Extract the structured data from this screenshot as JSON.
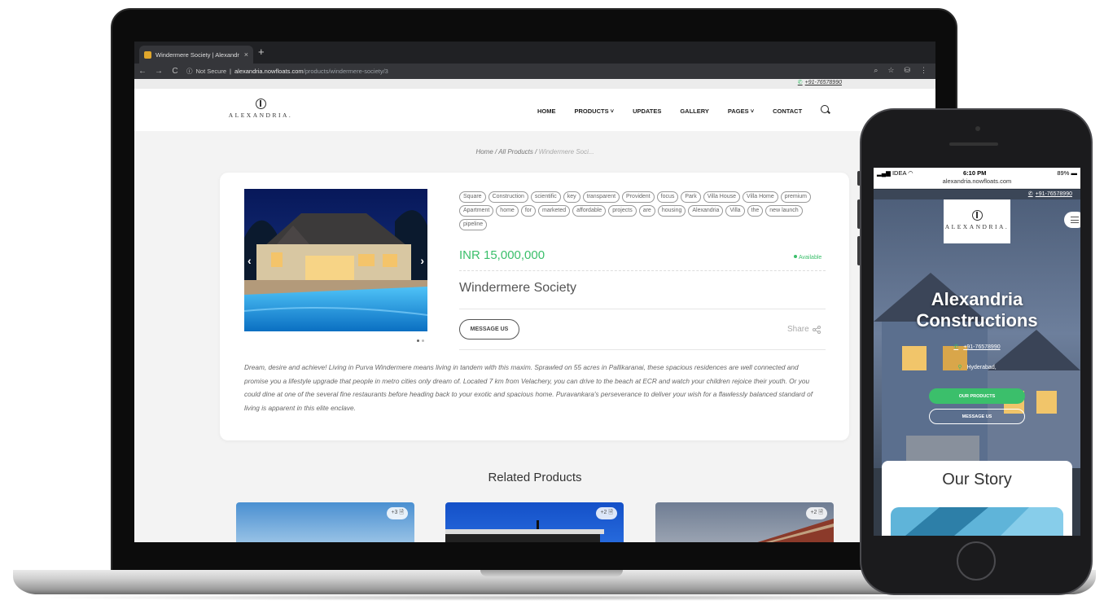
{
  "browser": {
    "tab_title": "Windermere Society | Alexandr",
    "tab_close": "×",
    "new_tab": "+",
    "security": "Not Secure",
    "url_host": "alexandria.nowfloats.com",
    "url_path": "/products/windermere-society/3",
    "nav_back": "←",
    "nav_forward": "→",
    "nav_reload": "C"
  },
  "site": {
    "phone": "+91-76578990",
    "logo_text": "ALEXANDRIA.",
    "menu": [
      "HOME",
      "PRODUCTS ˅",
      "UPDATES",
      "GALLERY",
      "PAGES ˅",
      "CONTACT"
    ],
    "breadcrumb": {
      "home": "Home",
      "sep1": "/",
      "all": "All Products",
      "sep2": "/",
      "current": "Windermere Soci..."
    }
  },
  "product": {
    "tags": [
      "Square",
      "Construction",
      "scientific",
      "key",
      "transparent",
      "Provident",
      "focus",
      "Park",
      "Villa House",
      "Villa Home",
      "premium",
      "Apartment",
      "home",
      "for",
      "marketed",
      "affordable",
      "projects",
      "are",
      "housing",
      "Alexandria",
      "Villa",
      "the",
      "new launch",
      "pipeline"
    ],
    "price": "INR 15,000,000",
    "availability": "Available",
    "name": "Windermere Society",
    "message_button": "MESSAGE US",
    "share_label": "Share",
    "description": "Dream, desire and achieve! Living in Purva Windermere means living in tandem with this maxim. Sprawled on 55 acres in Pallikaranai, these spacious residences are well connected and promise you a lifestyle upgrade that people in metro cities only dream of. Located 7 km from Velachery, you can drive to the beach at ECR and watch your children rejoice their youth. Or you could dine at one of the several fine restaurants before heading back to your exotic and spacious home. Puravankara's perseverance to deliver your wish for a flawlessly balanced standard of living is apparent in this elite enclave."
  },
  "related": {
    "title": "Related Products",
    "cards": [
      {
        "badge": "+3 🗎"
      },
      {
        "badge": "+2 🗎"
      },
      {
        "badge": "+2 🗎"
      }
    ]
  },
  "phone": {
    "carrier": "IDEA",
    "time": "6:10 PM",
    "battery": "89%",
    "url": "alexandria.nowfloats.com",
    "phone": "+91-76578990",
    "logo_text": "ALEXANDRIA.",
    "hero_title_1": "Alexandria",
    "hero_title_2": "Constructions",
    "contact_phone": "+91-76578990",
    "location": "Hyderabad,",
    "btn_products": "OUR PRODUCTS",
    "btn_message": "MESSAGE US",
    "story_title": "Our Story"
  },
  "colors": {
    "accent_green": "#3bbf6b",
    "header_bg": "#ffffff",
    "page_bg": "#f3f3f3"
  },
  "icons": [
    "phone-icon",
    "search-icon",
    "share-icon",
    "chevron-left-icon",
    "chevron-right-icon",
    "location-icon",
    "menu-icon",
    "document-icon"
  ]
}
